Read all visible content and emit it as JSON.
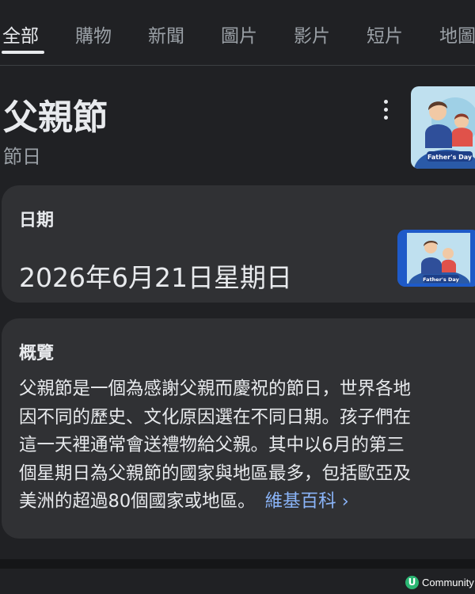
{
  "tabs": [
    {
      "label": "全部",
      "active": true
    },
    {
      "label": "購物"
    },
    {
      "label": "新聞"
    },
    {
      "label": "圖片"
    },
    {
      "label": "影片"
    },
    {
      "label": "短片"
    },
    {
      "label": "地圖"
    }
  ],
  "header": {
    "title": "父親節",
    "subtitle": "節日",
    "thumbnail_caption": "Father's Day"
  },
  "date_card": {
    "label": "日期",
    "value": "2026年6月21日星期日",
    "thumbnail_caption": "Father's Day"
  },
  "overview_card": {
    "label": "概覽",
    "lines": [
      "父親節是一個為感謝父親而慶祝的節日，世界各地",
      "因不同的歷史、文化原因選在不同日期。孩子們在",
      "這一天裡通常會送禮物給父親。其中以6月的第三",
      "個星期日為父親節的國家與地區最多，包括歐亞及",
      "美洲的超過80個國家或地區。"
    ],
    "link_label": "維基百科 ›"
  },
  "watermark": {
    "badge": "U",
    "text": "Community"
  },
  "colors": {
    "background": "#202124",
    "card": "#303134",
    "text": "#e8eaed",
    "muted": "#9aa0a6",
    "link": "#8ab4f8"
  }
}
